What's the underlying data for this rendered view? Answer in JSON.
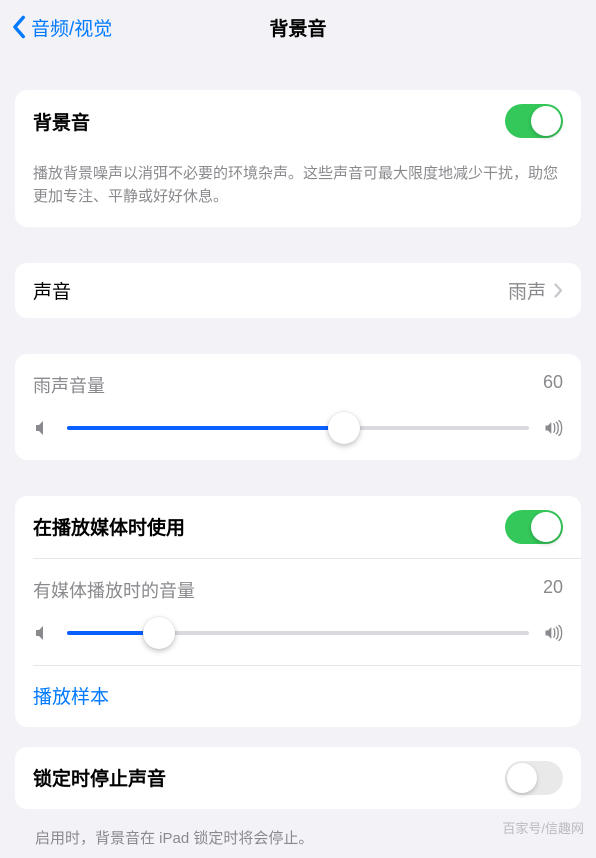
{
  "nav": {
    "back": "音频/视觉",
    "title": "背景音"
  },
  "bgsound": {
    "label": "背景音",
    "on": true,
    "desc": "播放背景噪声以消弭不必要的环境杂声。这些声音可最大限度地减少干扰，助您更加专注、平静或好好休息。"
  },
  "sound": {
    "label": "声音",
    "value": "雨声"
  },
  "vol1": {
    "label": "雨声音量",
    "value": 60,
    "percent": 60
  },
  "media": {
    "use_label": "在播放媒体时使用",
    "use_on": true,
    "vol_label": "有媒体播放时的音量",
    "vol_value": 20,
    "vol_percent": 20,
    "sample": "播放样本"
  },
  "lock": {
    "label": "锁定时停止声音",
    "on": false,
    "desc": "启用时，背景音在 iPad 锁定时将会停止。"
  },
  "watermark": "百家号/信趣网"
}
